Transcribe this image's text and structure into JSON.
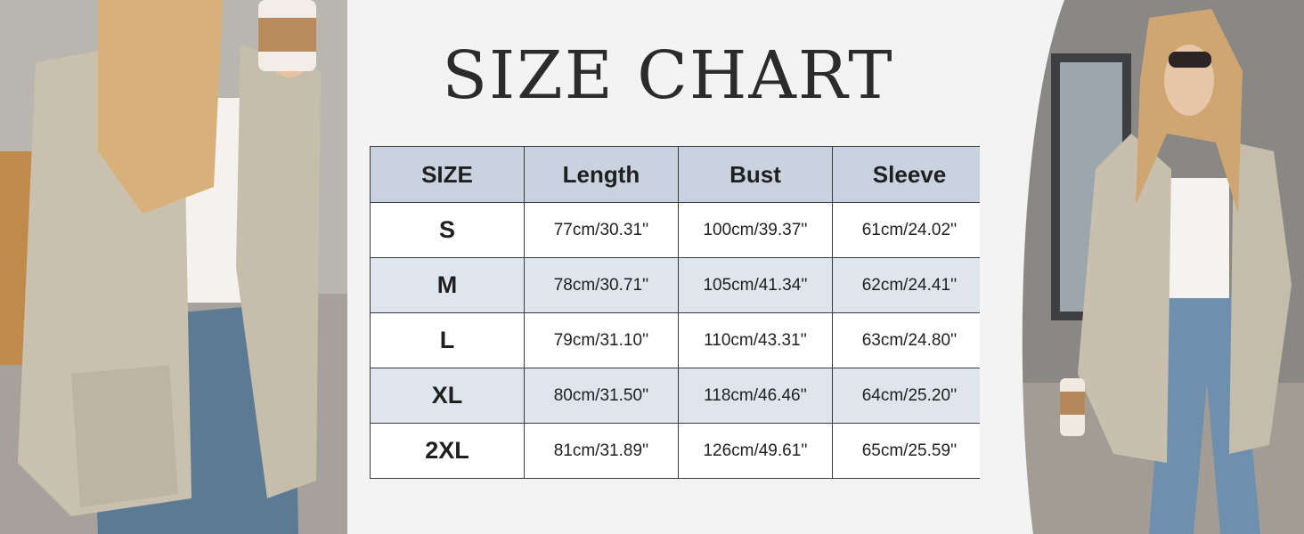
{
  "title": "SIZE CHART",
  "table": {
    "headers": [
      "SIZE",
      "Length",
      "Bust",
      "Sleeve"
    ],
    "rows": [
      [
        "S",
        "77cm/30.31''",
        "100cm/39.37''",
        "61cm/24.02''"
      ],
      [
        "M",
        "78cm/30.71''",
        "105cm/41.34''",
        "62cm/24.41''"
      ],
      [
        "L",
        "79cm/31.10''",
        "110cm/43.31''",
        "63cm/24.80''"
      ],
      [
        "XL",
        "80cm/31.50''",
        "118cm/46.46''",
        "64cm/25.20''"
      ],
      [
        "2XL",
        "81cm/31.89''",
        "126cm/49.61''",
        "65cm/25.59''"
      ]
    ]
  },
  "colors": {
    "header_bg": "#c8d3df",
    "alt_row_bg": "#dfe5ec",
    "cardigan": "#c9c0ae"
  }
}
